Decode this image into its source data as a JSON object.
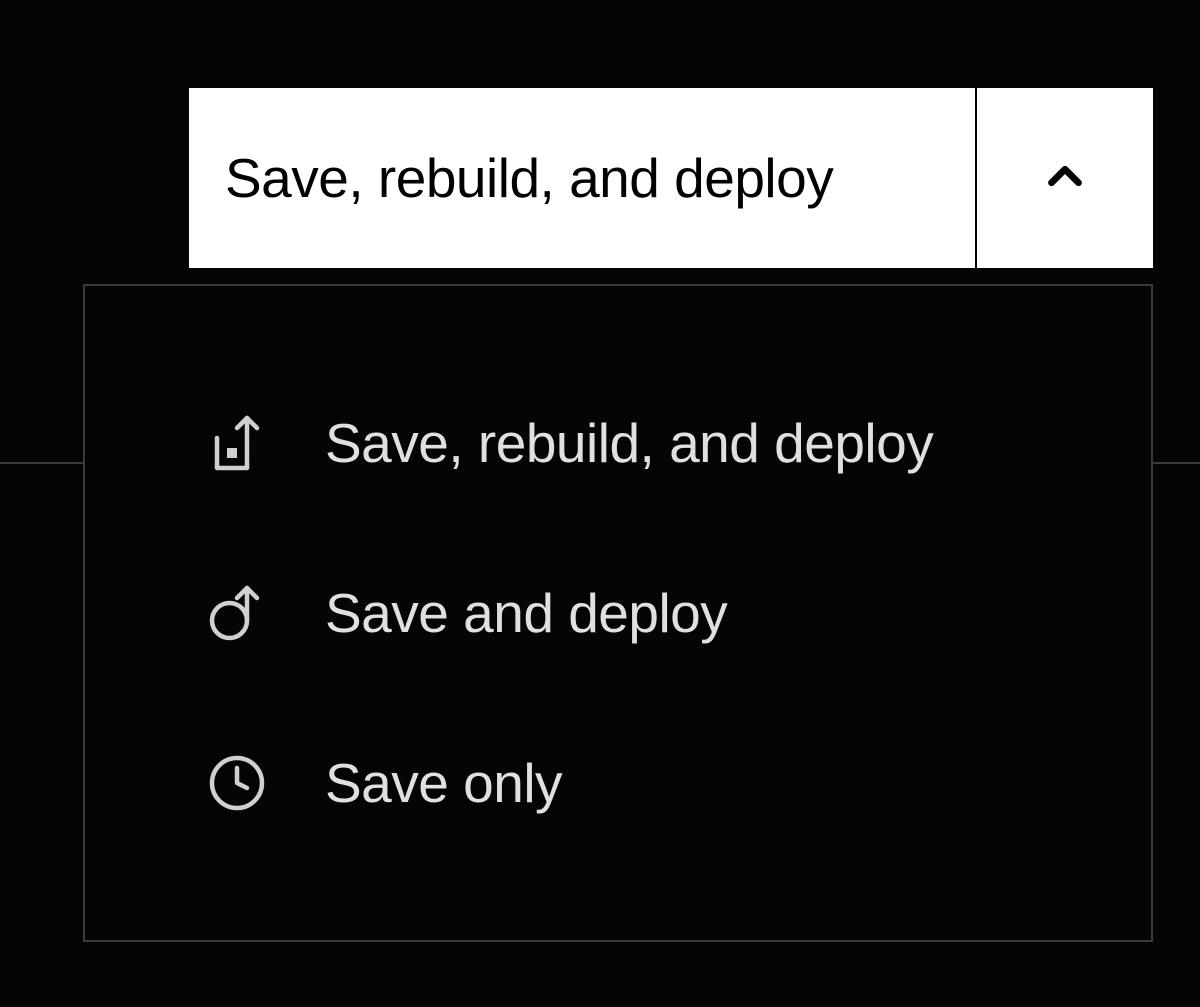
{
  "splitButton": {
    "mainLabel": "Save, rebuild, and deploy"
  },
  "menu": {
    "items": [
      {
        "label": "Save, rebuild, and deploy",
        "icon": "box-arrow-up-icon"
      },
      {
        "label": "Save and deploy",
        "icon": "circle-arrow-up-icon"
      },
      {
        "label": "Save only",
        "icon": "clock-icon"
      }
    ]
  }
}
